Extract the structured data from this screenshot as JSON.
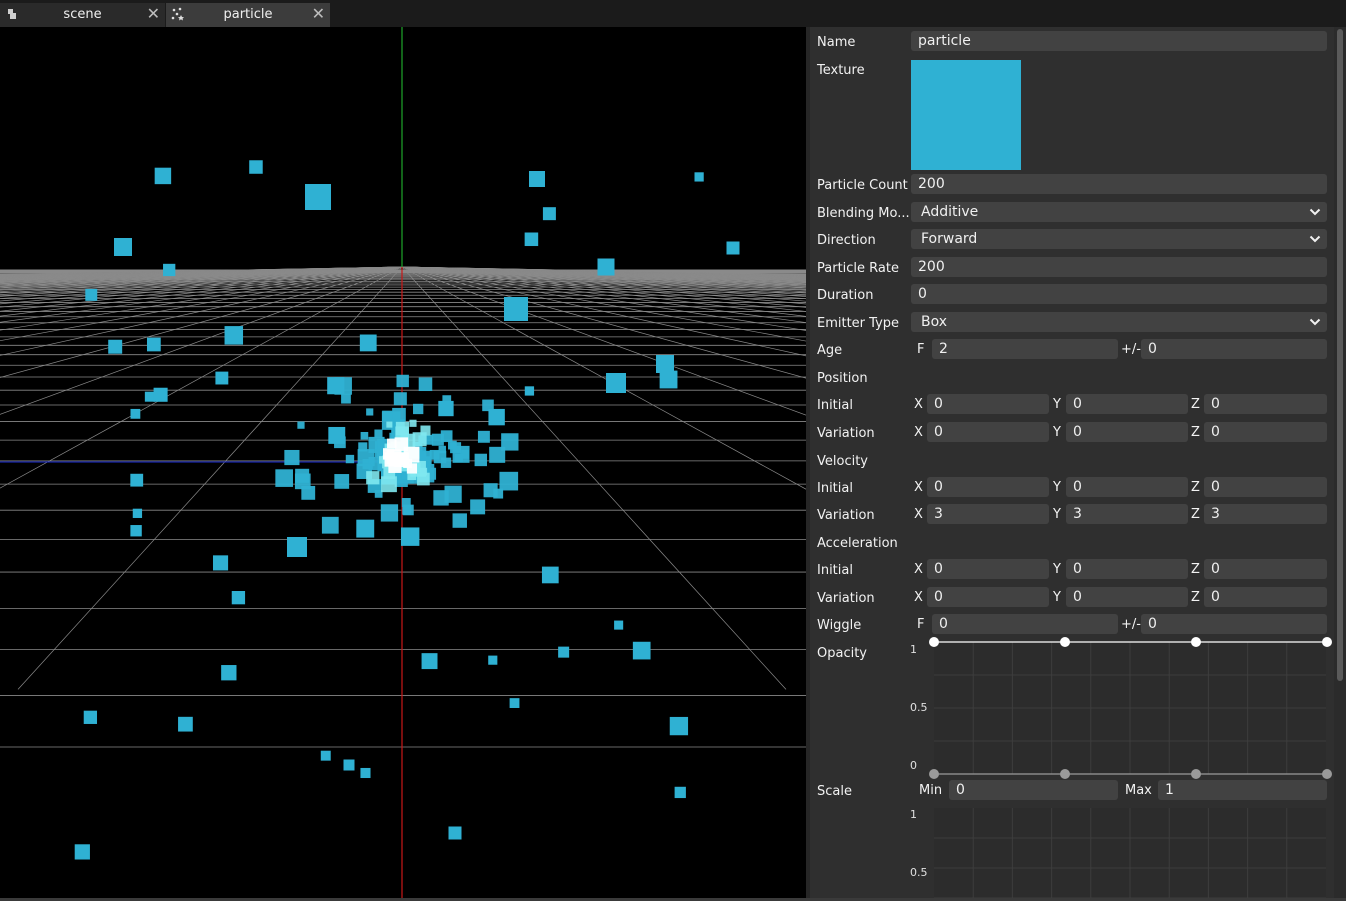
{
  "tabs": [
    {
      "label": "scene",
      "icon": "scene-icon",
      "active": false
    },
    {
      "label": "particle",
      "icon": "particle-icon",
      "active": true
    }
  ],
  "properties": {
    "name": {
      "label": "Name",
      "value": "particle"
    },
    "texture": {
      "label": "Texture",
      "color": "#2fb1d3"
    },
    "particle_count": {
      "label": "Particle Count",
      "value": "200"
    },
    "blending_mode": {
      "label": "Blending Mo...",
      "value": "Additive"
    },
    "direction": {
      "label": "Direction",
      "value": "Forward"
    },
    "particle_rate": {
      "label": "Particle Rate",
      "value": "200"
    },
    "duration": {
      "label": "Duration",
      "value": "0"
    },
    "emitter_type": {
      "label": "Emitter Type",
      "value": "Box"
    },
    "age": {
      "label": "Age",
      "f_label": "F",
      "f_value": "2",
      "pm_label": "+/-",
      "pm_value": "0"
    },
    "position": {
      "label": "Position",
      "initial": {
        "label": "Initial",
        "x": "0",
        "y": "0",
        "z": "0"
      },
      "variation": {
        "label": "Variation",
        "x": "0",
        "y": "0",
        "z": "0"
      }
    },
    "velocity": {
      "label": "Velocity",
      "initial": {
        "label": "Initial",
        "x": "0",
        "y": "0",
        "z": "0"
      },
      "variation": {
        "label": "Variation",
        "x": "3",
        "y": "3",
        "z": "3"
      }
    },
    "acceleration": {
      "label": "Acceleration",
      "initial": {
        "label": "Initial",
        "x": "0",
        "y": "0",
        "z": "0"
      },
      "variation": {
        "label": "Variation",
        "x": "0",
        "y": "0",
        "z": "0"
      }
    },
    "wiggle": {
      "label": "Wiggle",
      "f_label": "F",
      "f_value": "0",
      "pm_label": "+/-",
      "pm_value": "0"
    },
    "opacity": {
      "label": "Opacity",
      "tick_1": "1",
      "tick_05": "0.5",
      "tick_0": "0"
    },
    "scale": {
      "label": "Scale",
      "min_label": "Min",
      "min_value": "0",
      "max_label": "Max",
      "max_value": "1",
      "tick_1": "1",
      "tick_05": "0.5"
    }
  },
  "axis_labels": {
    "x": "X",
    "y": "Y",
    "z": "Z"
  },
  "colors": {
    "accent": "#2fb1d3",
    "panel_bg": "#2f2f2f",
    "field_bg": "#424242",
    "viewport_bg": "#000000"
  }
}
